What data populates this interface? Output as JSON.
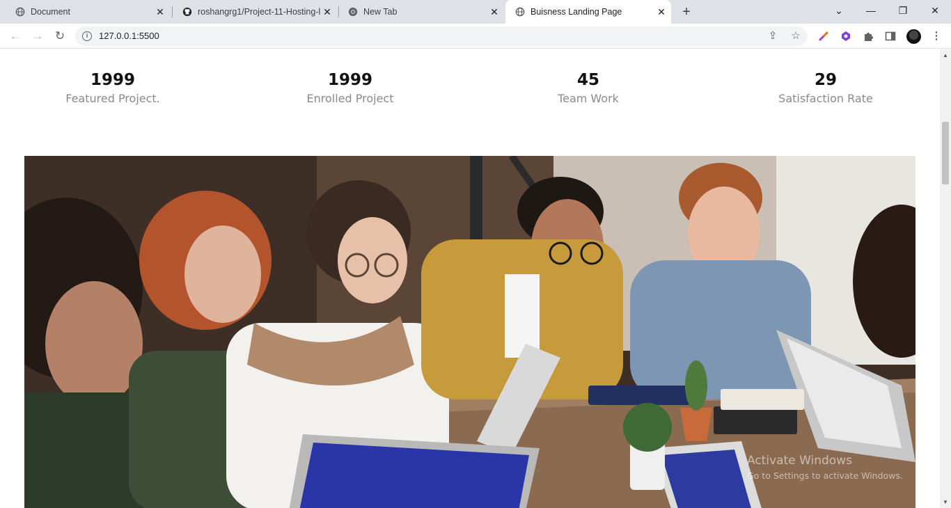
{
  "browser": {
    "tabs": [
      {
        "title": "Document",
        "icon": "globe-icon",
        "active": false
      },
      {
        "title": "roshangrg1/Project-11-Hosting-l",
        "icon": "github-icon",
        "active": false
      },
      {
        "title": "New Tab",
        "icon": "chrome-icon",
        "active": false
      },
      {
        "title": "Buisness Landing Page",
        "icon": "globe-icon",
        "active": true
      }
    ],
    "close_glyph": "✕",
    "new_tab_glyph": "+",
    "window_controls": {
      "dropdown": "⌄",
      "minimize": "—",
      "restore": "❐",
      "close": "✕"
    },
    "url": "127.0.0.1:5500",
    "nav": {
      "back": "←",
      "forward": "→",
      "reload": "↻"
    }
  },
  "stats": [
    {
      "value": "1999",
      "label": "Featured Project."
    },
    {
      "value": "1999",
      "label": "Enrolled Project"
    },
    {
      "value": "45",
      "label": "Team Work"
    },
    {
      "value": "29",
      "label": "Satisfaction Rate"
    }
  ],
  "hero_image": {
    "alt": "Team working together at a table with laptops"
  },
  "watermark": {
    "line1": "Activate Windows",
    "line2": "Go to Settings to activate Windows."
  }
}
